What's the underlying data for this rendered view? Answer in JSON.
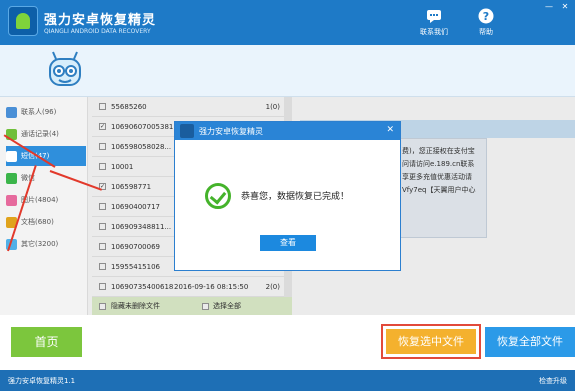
{
  "app": {
    "title": "强力安卓恢复精灵",
    "subtitle": "QIANGLI ANDROID DATA RECOVERY"
  },
  "toolbar": {
    "contact": "联系我们",
    "help": "帮助"
  },
  "window_controls": {
    "minimize": "—",
    "close": "✕"
  },
  "sidebar": {
    "items": [
      {
        "label": "联系人(96)",
        "color": "#4a8fd6"
      },
      {
        "label": "通话记录(4)",
        "color": "#6fbf3a"
      },
      {
        "label": "短信(47)",
        "color": "#ffffff"
      },
      {
        "label": "微信",
        "color": "#3bb54a"
      },
      {
        "label": "图片(4804)",
        "color": "#e66a9d"
      },
      {
        "label": "文档(680)",
        "color": "#e0a31c"
      },
      {
        "label": "其它(3200)",
        "color": "#4fb0e8"
      }
    ]
  },
  "list": {
    "rows": [
      {
        "name": "55685260",
        "checked": false,
        "date": "",
        "count": "1(0)"
      },
      {
        "name": "10690607005381",
        "checked": true,
        "date": "",
        "count": ""
      },
      {
        "name": "106598058028...",
        "checked": false,
        "date": "",
        "count": ""
      },
      {
        "name": "10001",
        "checked": false,
        "date": "",
        "count": ""
      },
      {
        "name": "106598771",
        "checked": true,
        "date": "",
        "count": ""
      },
      {
        "name": "10690400717",
        "checked": false,
        "date": "",
        "count": ""
      },
      {
        "name": "106909348811...",
        "checked": false,
        "date": "",
        "count": ""
      },
      {
        "name": "10690700069",
        "checked": false,
        "date": "",
        "count": ""
      },
      {
        "name": "15955415106",
        "checked": false,
        "date": "",
        "count": ""
      },
      {
        "name": "10690735400618",
        "checked": false,
        "date": "2016-09-16 08:15:50",
        "count": "2(0)"
      }
    ],
    "hide_deleted": "隐藏未删除文件",
    "select_all": "选择全部"
  },
  "detail": {
    "message_text": "费)，您正接权在支付宝问请访问e.189.cn联系享更多充值优惠活动请Vfy7eq【天翼用户中心"
  },
  "modal": {
    "title": "强力安卓恢复精灵",
    "message": "恭喜您，数据恢复已完成！",
    "view_button": "查看"
  },
  "bottom": {
    "home": "首页",
    "restore_selected": "恢复选中文件",
    "restore_all": "恢复全部文件"
  },
  "status": {
    "version": "强力安卓恢复精灵1.1",
    "update": "检查升级"
  },
  "colors": {
    "brand_blue": "#1e7ac7",
    "accent_green": "#7cc63d",
    "accent_orange": "#f4b12e",
    "annotation_red": "#e24a3a"
  }
}
